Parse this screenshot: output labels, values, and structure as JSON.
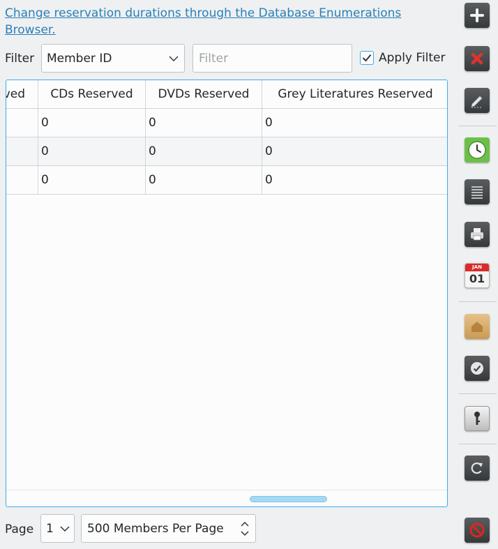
{
  "link": {
    "text": "Change reservation durations through the Database Enumerations Browser."
  },
  "filter": {
    "label": "Filter",
    "field_value": "Member ID",
    "input_value": "",
    "input_placeholder": "Filter",
    "apply_label": "Apply Filter",
    "apply_checked": true
  },
  "table": {
    "columns": [
      "ved",
      "CDs Reserved",
      "DVDs Reserved",
      "Grey Literatures Reserved"
    ],
    "rows": [
      [
        "",
        "0",
        "0",
        "0"
      ],
      [
        "",
        "0",
        "0",
        "0"
      ],
      [
        "",
        "0",
        "0",
        "0"
      ]
    ]
  },
  "pager": {
    "label": "Page",
    "page_value": "1",
    "per_page_value": "500 Members Per Page"
  },
  "toolbar": {
    "icons": [
      "add-icon",
      "delete-icon",
      "edit-icon",
      "clock-icon",
      "list-icon",
      "print-icon",
      "calendar-icon",
      "home-folder-icon",
      "check-icon",
      "key-icon",
      "refresh-icon",
      "cancel-icon"
    ],
    "calendar_day": "01",
    "calendar_month": "JAN"
  },
  "colors": {
    "accent": "#3daee9",
    "link": "#2980b9",
    "delete": "#e0332b",
    "clock": "#6cc04a",
    "calendar": "#d92b2b",
    "cancel": "#d8281d"
  }
}
